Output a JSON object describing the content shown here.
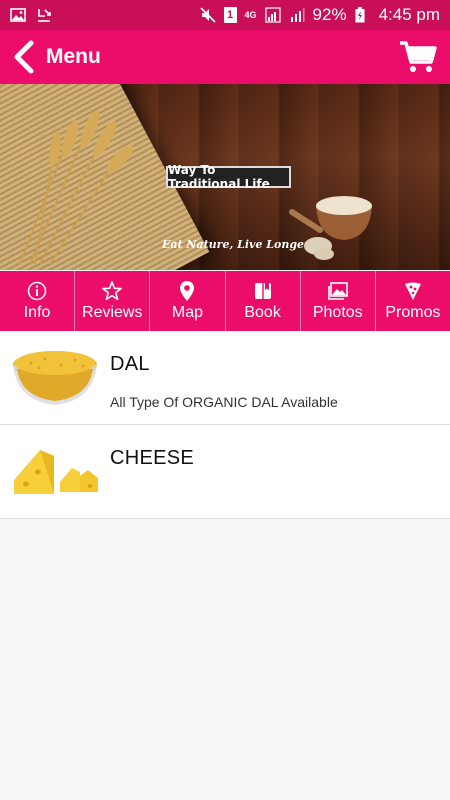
{
  "status_bar": {
    "left_icons": [
      "image-icon",
      "download-icon"
    ],
    "battery": "92%",
    "time": "4:45 pm",
    "network": "4G",
    "sim": "1"
  },
  "app_bar": {
    "title": "Menu",
    "back_icon": "chevron-left-icon",
    "cart_icon": "cart-icon"
  },
  "banner": {
    "headline": "Way To Traditional Life",
    "tagline": "Eat Nature, Live Longer"
  },
  "tabs": [
    {
      "label": "Info",
      "icon": "info-icon"
    },
    {
      "label": "Reviews",
      "icon": "star-icon"
    },
    {
      "label": "Map",
      "icon": "map-pin-icon"
    },
    {
      "label": "Book",
      "icon": "book-icon"
    },
    {
      "label": "Photos",
      "icon": "photos-icon"
    },
    {
      "label": "Promos",
      "icon": "pizza-icon"
    }
  ],
  "menu_items": [
    {
      "title": "DAL",
      "description": "All Type Of ORGANIC DAL Available"
    },
    {
      "title": "CHEESE",
      "description": ""
    }
  ],
  "colors": {
    "primary": "#ec0c6a",
    "status_bar": "#c90f58",
    "divider": "#f57fb0"
  }
}
